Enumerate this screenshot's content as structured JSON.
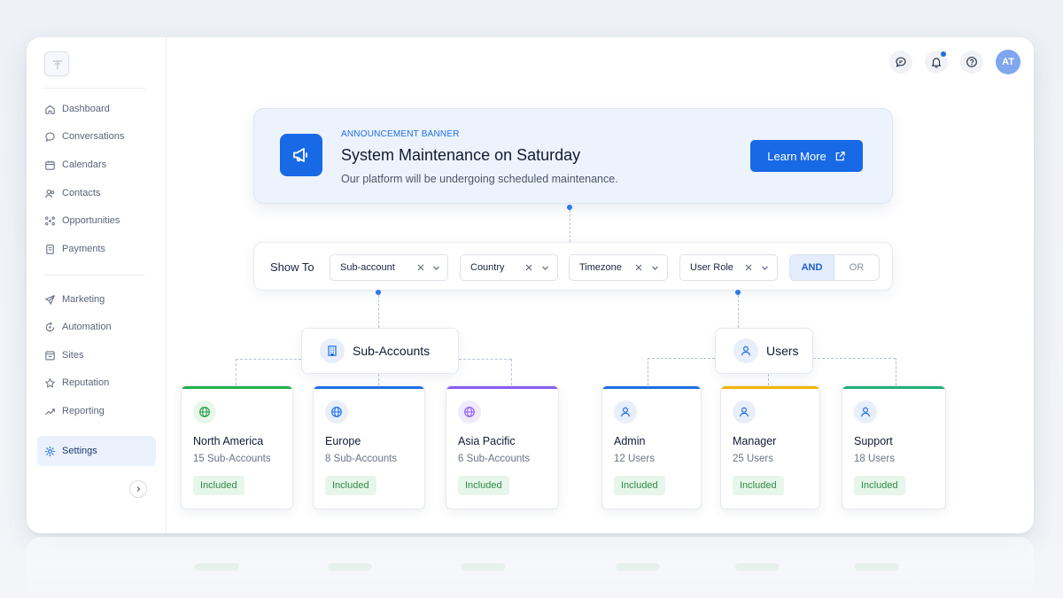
{
  "sidebar": {
    "items": [
      {
        "label": "Dashboard",
        "icon": "home-icon"
      },
      {
        "label": "Conversations",
        "icon": "chat-icon"
      },
      {
        "label": "Calendars",
        "icon": "calendar-icon"
      },
      {
        "label": "Contacts",
        "icon": "contacts-icon"
      },
      {
        "label": "Opportunities",
        "icon": "opportunities-icon"
      },
      {
        "label": "Payments",
        "icon": "payments-icon"
      },
      {
        "label": "Marketing",
        "icon": "send-icon"
      },
      {
        "label": "Automation",
        "icon": "automation-icon"
      },
      {
        "label": "Sites",
        "icon": "sites-icon"
      },
      {
        "label": "Reputation",
        "icon": "star-icon"
      },
      {
        "label": "Reporting",
        "icon": "trend-icon"
      },
      {
        "label": "Settings",
        "icon": "gear-icon",
        "active": true
      }
    ]
  },
  "header": {
    "avatar_initials": "AT",
    "icons": [
      "chat-icon",
      "bell-icon",
      "help-icon"
    ],
    "has_notification": true
  },
  "banner": {
    "eyebrow": "ANNOUNCEMENT BANNER",
    "title": "System Maintenance on Saturday",
    "description": "Our platform will be undergoing scheduled maintenance.",
    "button_label": "Learn More",
    "icon": "megaphone-icon"
  },
  "filters": {
    "label": "Show To",
    "items": [
      {
        "label": "Sub-account"
      },
      {
        "label": "Country"
      },
      {
        "label": "Timezone"
      },
      {
        "label": "User Role"
      }
    ],
    "logic": {
      "and_label": "AND",
      "or_label": "OR",
      "selected": "AND"
    }
  },
  "groups": {
    "subaccounts": {
      "title": "Sub-Accounts",
      "icon": "building-icon",
      "cards": [
        {
          "title": "North America",
          "subtitle": "15 Sub-Accounts",
          "badge": "Included",
          "accent": "#22b04b",
          "icon": "globe-icon"
        },
        {
          "title": "Europe",
          "subtitle": "8 Sub-Accounts",
          "badge": "Included",
          "accent": "#1f6fe5",
          "icon": "globe-icon"
        },
        {
          "title": "Asia Pacific",
          "subtitle": "6 Sub-Accounts",
          "badge": "Included",
          "accent": "#8a5cf0",
          "icon": "globe-icon"
        }
      ]
    },
    "users": {
      "title": "Users",
      "icon": "user-icon",
      "cards": [
        {
          "title": "Admin",
          "subtitle": "12 Users",
          "badge": "Included",
          "accent": "#1f6fe5",
          "icon": "user-icon"
        },
        {
          "title": "Manager",
          "subtitle": "25 Users",
          "badge": "Included",
          "accent": "#f5b400",
          "icon": "user-icon"
        },
        {
          "title": "Support",
          "subtitle": "18 Users",
          "badge": "Included",
          "accent": "#1fb07a",
          "icon": "user-icon"
        }
      ]
    }
  },
  "colors": {
    "primary": "#1769e6",
    "success_text": "#2e8a45",
    "success_bg": "#e7f6ea"
  }
}
